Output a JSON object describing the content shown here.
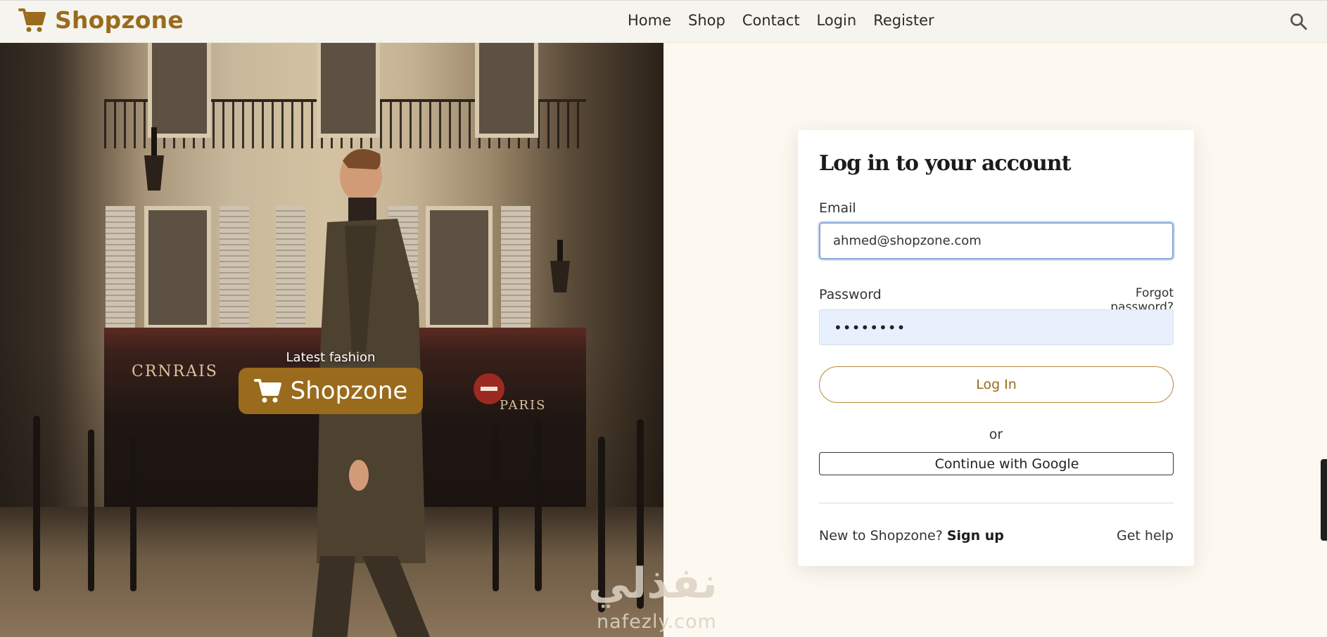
{
  "navbar": {
    "brand": "Shopzone",
    "links": [
      "Home",
      "Shop",
      "Contact",
      "Login",
      "Register"
    ],
    "search_icon": "search-icon"
  },
  "hero": {
    "tagline": "Latest fashion",
    "badge": "Shopzone",
    "signage": [
      "CRNRAIS",
      "PARIS"
    ]
  },
  "login": {
    "title": "Log in to your account",
    "email_label": "Email",
    "email_value": "ahmed@shopzone.com",
    "password_label": "Password",
    "forgot_label": "Forgot password?",
    "password_value": "••••••••",
    "login_button": "Log In",
    "or_text": "or",
    "google_button": "Continue with Google",
    "new_text": "New to Shopzone?",
    "signup_label": "Sign up",
    "help_label": "Get help"
  },
  "watermark": {
    "arabic": "نفذلي",
    "latin": "nafezly.com"
  },
  "colors": {
    "brand": "#9a6b1c",
    "page_bg": "#fdf9f1",
    "focus": "#86a7d6",
    "autofill_bg": "#e8f0fd"
  }
}
